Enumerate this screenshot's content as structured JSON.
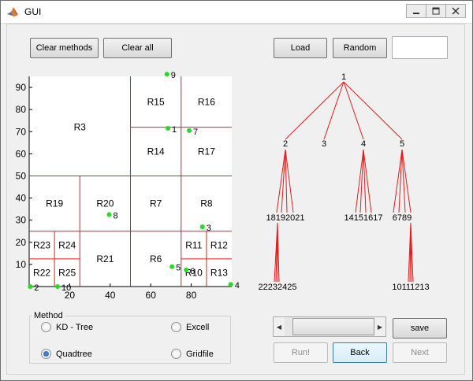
{
  "window": {
    "title": "GUI"
  },
  "buttons": {
    "clear_methods": "Clear methods",
    "clear_all": "Clear all",
    "load": "Load",
    "random": "Random",
    "save": "save",
    "run": "Run!",
    "back": "Back",
    "next": "Next"
  },
  "text_box": {
    "value": ""
  },
  "method_panel": {
    "title": "Method",
    "options": [
      {
        "label": "KD - Tree",
        "selected": false
      },
      {
        "label": "Excell",
        "selected": false
      },
      {
        "label": "Quadtree",
        "selected": true
      },
      {
        "label": "Gridfile",
        "selected": false
      }
    ]
  },
  "slider": {
    "position": 0.15
  },
  "colors": {
    "region_lines": "#e21d1d",
    "points": "#22dd22",
    "tree_edges": "#e21d1d"
  },
  "chart_data": {
    "type": "scatter",
    "xlim": [
      0,
      100
    ],
    "ylim": [
      0,
      95
    ],
    "xticks": [
      "20",
      "40",
      "60",
      "80"
    ],
    "yticks": [
      "10",
      "20",
      "30",
      "40",
      "50",
      "60",
      "70",
      "80",
      "90"
    ],
    "points": [
      {
        "label": "1",
        "x": 68.5,
        "y": 71.5
      },
      {
        "label": "2",
        "x": 0.5,
        "y": 0
      },
      {
        "label": "3",
        "x": 85.5,
        "y": 27
      },
      {
        "label": "4",
        "x": 99.5,
        "y": 1
      },
      {
        "label": "5",
        "x": 70.5,
        "y": 9
      },
      {
        "label": "6",
        "x": 77.5,
        "y": 7.5
      },
      {
        "label": "7",
        "x": 79,
        "y": 70.5
      },
      {
        "label": "8",
        "x": 39.5,
        "y": 32.5
      },
      {
        "label": "9",
        "x": 68,
        "y": 96
      },
      {
        "label": "10",
        "x": 14,
        "y": 0
      }
    ],
    "v_segments": [
      {
        "x": 50,
        "y1": 0,
        "y2": 95
      },
      {
        "x": 75,
        "y1": 0,
        "y2": 95
      },
      {
        "x": 25,
        "y1": 0,
        "y2": 50
      },
      {
        "x": 12.5,
        "y1": 0,
        "y2": 25
      },
      {
        "x": 87.5,
        "y1": 0,
        "y2": 25
      }
    ],
    "h_segments": [
      {
        "y": 50,
        "x1": 0,
        "x2": 100
      },
      {
        "y": 25,
        "x1": 0,
        "x2": 100
      },
      {
        "y": 72,
        "x1": 50,
        "x2": 100
      },
      {
        "y": 12.5,
        "x1": 0,
        "x2": 25
      },
      {
        "y": 12.5,
        "x1": 75,
        "x2": 100
      }
    ],
    "regions": [
      {
        "label": "R3",
        "x": 25,
        "y": 72
      },
      {
        "label": "R15",
        "x": 62.5,
        "y": 83.5
      },
      {
        "label": "R16",
        "x": 87.5,
        "y": 83.5
      },
      {
        "label": "R14",
        "x": 62.5,
        "y": 61
      },
      {
        "label": "R17",
        "x": 87.5,
        "y": 61
      },
      {
        "label": "R19",
        "x": 12.5,
        "y": 37.5
      },
      {
        "label": "R20",
        "x": 37.5,
        "y": 37.5
      },
      {
        "label": "R7",
        "x": 62.5,
        "y": 37.5
      },
      {
        "label": "R8",
        "x": 87.5,
        "y": 37.5
      },
      {
        "label": "R23",
        "x": 6.25,
        "y": 18.75
      },
      {
        "label": "R24",
        "x": 18.75,
        "y": 18.75
      },
      {
        "label": "R22",
        "x": 6.25,
        "y": 6.25
      },
      {
        "label": "R25",
        "x": 18.75,
        "y": 6.25
      },
      {
        "label": "R21",
        "x": 37.5,
        "y": 12.5
      },
      {
        "label": "R6",
        "x": 62.5,
        "y": 12.5
      },
      {
        "label": "R11",
        "x": 81.25,
        "y": 18.75
      },
      {
        "label": "R12",
        "x": 93.75,
        "y": 18.75
      },
      {
        "label": "R10",
        "x": 81.25,
        "y": 6.25
      },
      {
        "label": "R13",
        "x": 93.75,
        "y": 6.25
      }
    ]
  },
  "tree": {
    "root": "1",
    "level1": [
      "2",
      "3",
      "4",
      "5"
    ],
    "level2_labels": [
      "18192021",
      "14151617",
      "6789"
    ],
    "level3_labels": [
      "22232425",
      "10111213"
    ]
  }
}
